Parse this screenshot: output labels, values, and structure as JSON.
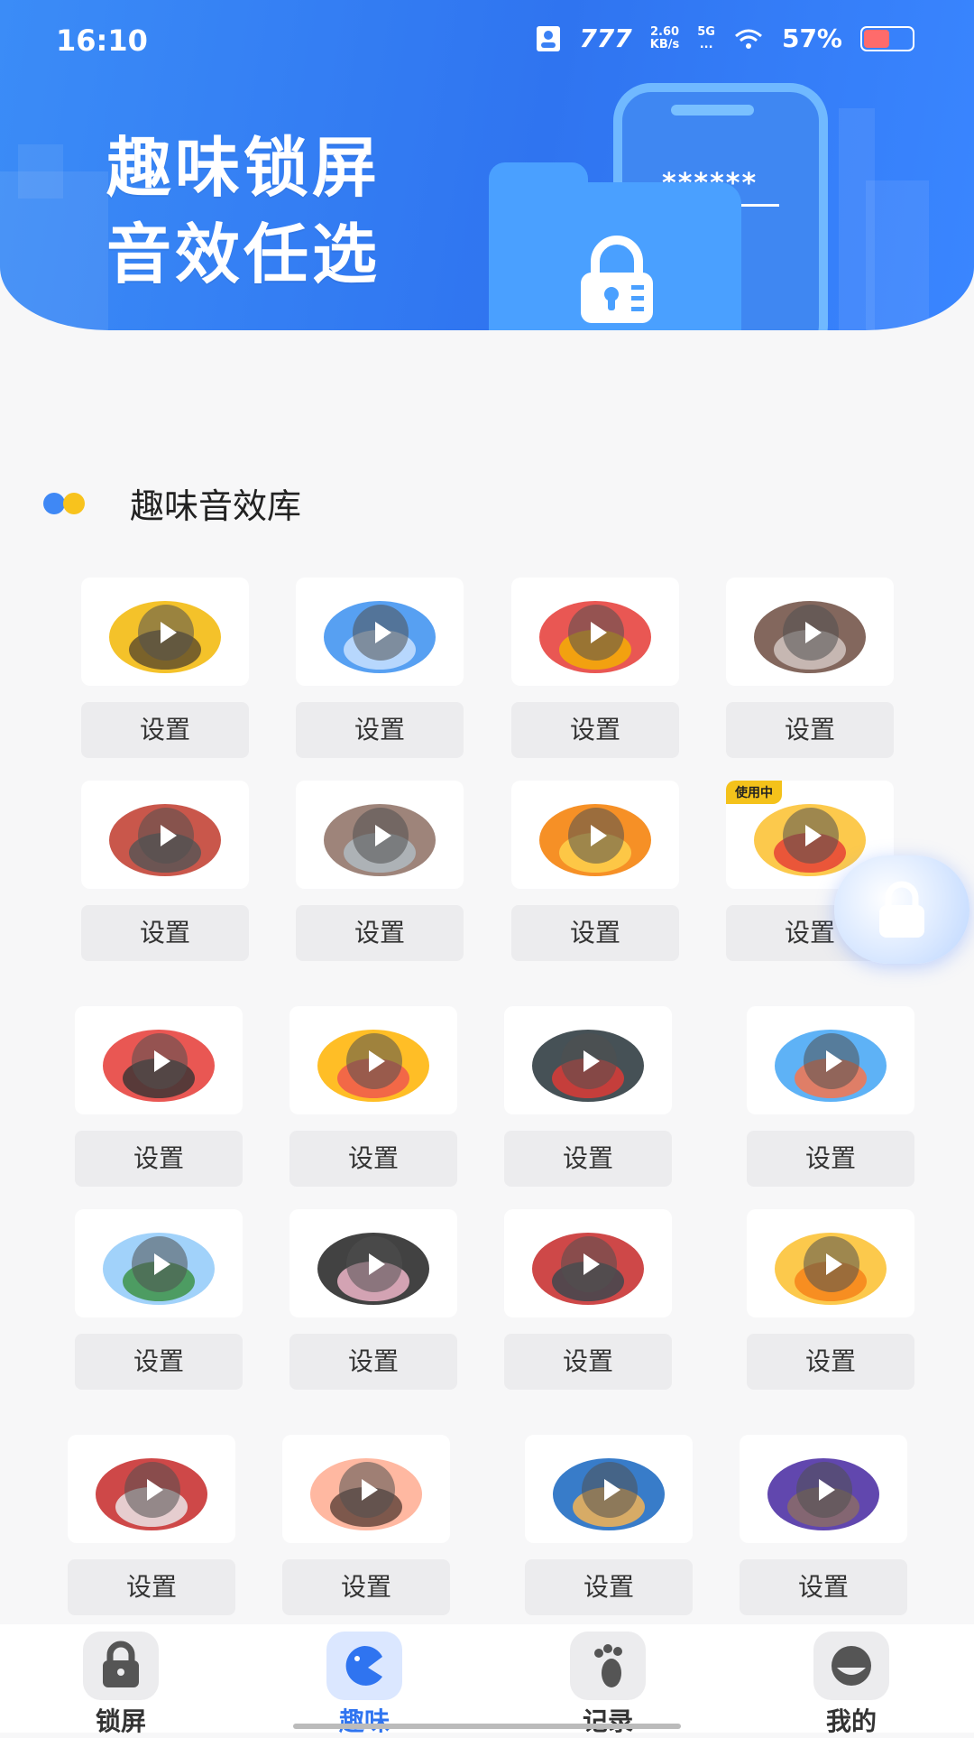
{
  "status_bar": {
    "time": "16:10",
    "carrier": "777",
    "speed_value": "2.60",
    "speed_unit": "KB/s",
    "network": "5G",
    "battery_percent": "57%",
    "battery_level": 0.57
  },
  "banner": {
    "line1": "趣味锁屏",
    "line2": "音效任选",
    "password_mask": "******"
  },
  "section": {
    "title": "趣味音效库"
  },
  "sounds": [
    {
      "icon": "burst-icon",
      "button": "设置"
    },
    {
      "icon": "dolphin-icon",
      "button": "设置"
    },
    {
      "icon": "alarm-siren-icon",
      "button": "设置"
    },
    {
      "icon": "wolf-icon",
      "button": "设置"
    },
    {
      "icon": "train-icon",
      "button": "设置"
    },
    {
      "icon": "revolver-icon",
      "button": "设置"
    },
    {
      "icon": "clown-icon",
      "button": "设置"
    },
    {
      "icon": "chicken-icon",
      "button": "设置",
      "badge": "使用中"
    },
    {
      "icon": "siren-icon",
      "button": "设置"
    },
    {
      "icon": "athlete-icon",
      "button": "设置"
    },
    {
      "icon": "spy-icon",
      "button": "设置"
    },
    {
      "icon": "fireworks-icon",
      "button": "设置"
    },
    {
      "icon": "typing-person-icon",
      "button": "设置"
    },
    {
      "icon": "girl-icon",
      "button": "设置"
    },
    {
      "icon": "ship-icon",
      "button": "设置"
    },
    {
      "icon": "explosion-icon",
      "button": "设置"
    },
    {
      "icon": "target-icon",
      "button": "设置"
    },
    {
      "icon": "punch-icon",
      "button": "设置"
    },
    {
      "icon": "megaphone-man-icon",
      "button": "设置"
    },
    {
      "icon": "witch-hat-icon",
      "button": "设置"
    }
  ],
  "tabs": [
    {
      "label": "锁屏",
      "icon": "lock-icon"
    },
    {
      "label": "趣味",
      "icon": "fun-icon",
      "active": true
    },
    {
      "label": "记录",
      "icon": "footprint-icon"
    },
    {
      "label": "我的",
      "icon": "profile-icon"
    }
  ],
  "colors": {
    "accent": "#2f74f0",
    "badge": "#f4c21b"
  }
}
